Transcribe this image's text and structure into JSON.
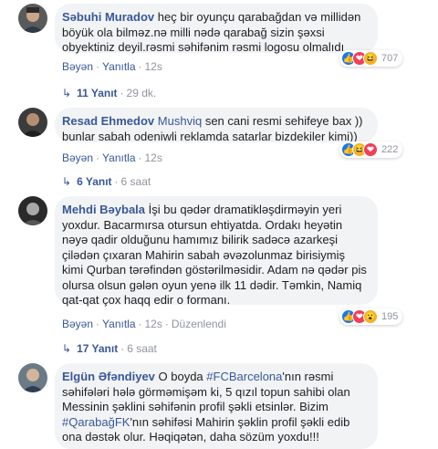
{
  "comments": [
    {
      "author": "Səbuhi Muradov",
      "text": " heç bir oyunçu qarabağdan və millidən böyük ola bilməz.nə milli nədə qarabağ sizin şəxsi obyektiniz deyil.rəsmi səhifənim rəsmi logosu olmalıdı",
      "like_label": "Bəyən",
      "reply_label": "Yanıtla",
      "time": "12s",
      "edited": "",
      "reactions": [
        "like",
        "love",
        "haha"
      ],
      "reaction_count": "707",
      "replies_label": "11 Yanıt",
      "replies_time": "29 dk."
    },
    {
      "author": "Resad Ehmedov",
      "mention": "Mushviq",
      "text": " sen cani resmi sehifeye bax )) bunlar sabah odeniwli reklamda satarlar bizdekiler kimi))",
      "like_label": "Bəyən",
      "reply_label": "Yanıtla",
      "time": "12s",
      "edited": "",
      "reactions": [
        "like",
        "haha",
        "love"
      ],
      "reaction_count": "222",
      "replies_label": "6 Yanıt",
      "replies_time": "6 saat"
    },
    {
      "author": "Mehdi Bəybala",
      "text": " İşi bu qədər dramatikləşdirməyin yeri yoxdur. Bacarmırsa otursun ehtiyatda. Ordakı heyətin nəyə qadir olduğunu hamımız bilirik sadəcə azarkeşi çilədən çıxaran Mahirin sabah əvəzolunmaz birisiymiş kimi Qurban tərəfindən göstərilməsidir. Adam nə qədər pis olursa olsun gələn oyun yenə ilk 11 dədir. Təmkin, Namiq qat-qat çox haqq edir o formanı.",
      "like_label": "Bəyən",
      "reply_label": "Yanıtla",
      "time": "12s",
      "edited": "Düzenlendi",
      "reactions": [
        "like",
        "love",
        "wow"
      ],
      "reaction_count": "195",
      "replies_label": "17 Yanıt",
      "replies_time": "6 saat"
    },
    {
      "author": "Elgün Əfəndiyev",
      "text_parts": [
        " O boyda ",
        "#FCBarcelona",
        "'nın rəsmi səhifələri hələ görməmişəm ki, 5 qızıl topun sahibi olan Messinin şəklini səhifənin profil şəkli etsinlər. Bizim ",
        "#QarabağFK",
        "'nın səhifəsi Mahirin şəklin profil şəkli edib ona dəstək olur. Həqiqətən, daha sözüm yoxdu!!!"
      ]
    }
  ]
}
